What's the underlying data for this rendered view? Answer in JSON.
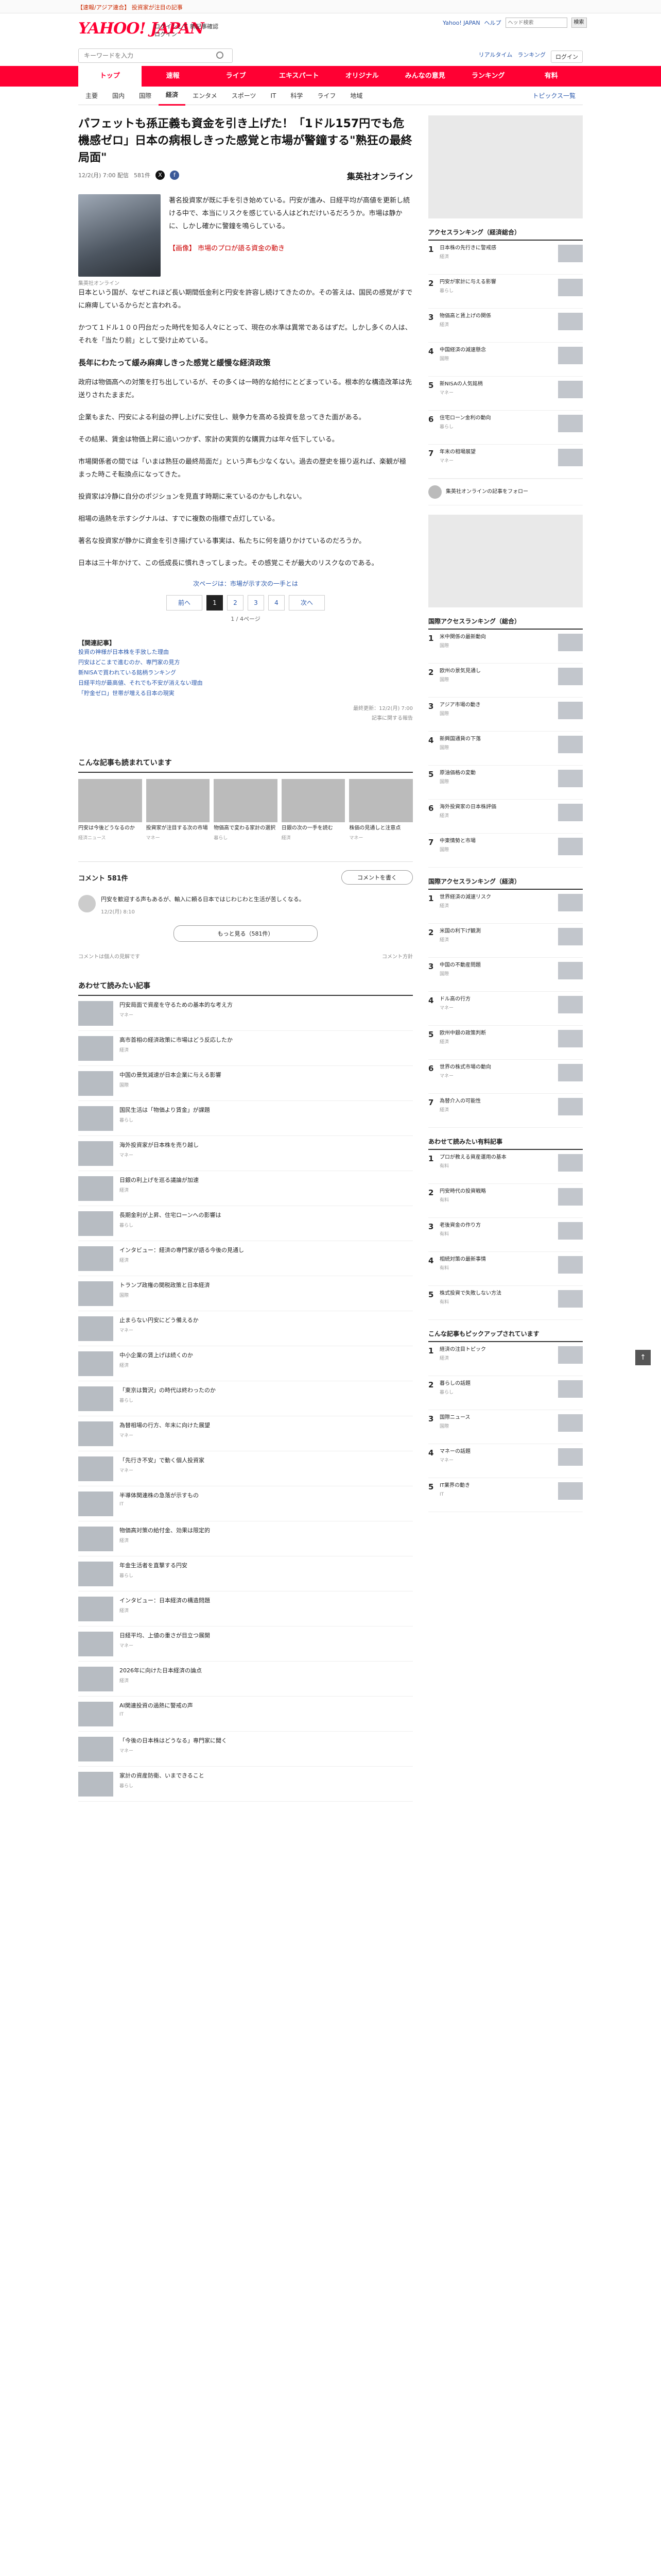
{
  "promo": "【速報/アジア連合】 投資家が注目の記事",
  "header": {
    "logo": "YAHOO! JAPAN",
    "logo_sub": "ニュース",
    "notice_line1": "ログインして 新記事確認",
    "notice_line2": "ログイン",
    "right_links": [
      "Yahoo! JAPAN",
      "ヘルプ"
    ],
    "right_placeholder": "ヘッド検索",
    "right_btn": "検索"
  },
  "search": {
    "placeholder": "キーワードを入力",
    "right": [
      "リアルタイム",
      "ランキング",
      "ログイン"
    ]
  },
  "nav": [
    "トップ",
    "速報",
    "ライブ",
    "エキスパート",
    "オリジナル",
    "みんなの意見",
    "ランキング",
    "有料"
  ],
  "subnav": [
    "主要",
    "国内",
    "国際",
    "経済",
    "エンタメ",
    "スポーツ",
    "IT",
    "科学",
    "ライフ",
    "地域"
  ],
  "subnav_topics": "トピックス一覧",
  "article": {
    "title": "パフェットも孫正義も資金を引き上げた！「1ドル157円でも危機感ゼロ」日本の病根しきった感覚と市場が警鐘する\"熟狂の最終局面\"",
    "date": "12/2(月) 7:00 配信",
    "comment_count": "581件",
    "publisher": "集英社オンライン",
    "photo_caption": "集英社オンライン",
    "lead": "著名投資家が既に手を引き始めている。円安が進み、日経平均が高値を更新し続ける中で、本当にリスクを感じている人はどれだけいるだろうか。市場は静かに、しかし確かに警鐘を鳴らしている。",
    "lead_red": "【画像】 市場のプロが語る資金の動き",
    "paragraphs": [
      "日本という国が、なぜこれほど長い期間低金利と円安を許容し続けてきたのか。その答えは、国民の感覚がすでに麻痺しているからだと言われる。",
      "かつて１ドル１００円台だった時代を知る人々にとって、現在の水準は異常であるはずだ。しかし多くの人は、それを「当たり前」として受け止めている。"
    ],
    "subhead": "長年にわたって緩み麻痺しきった感覚と緩慢な経済政策",
    "paragraphs2": [
      "政府は物価高への対策を打ち出しているが、その多くは一時的な給付にとどまっている。根本的な構造改革は先送りされたままだ。",
      "企業もまた、円安による利益の押し上げに安住し、競争力を高める投資を怠ってきた面がある。",
      "その結果、賃金は物価上昇に追いつかず、家計の実質的な購買力は年々低下している。",
      "市場関係者の間では「いまは熟狂の最終局面だ」という声も少なくない。過去の歴史を振り返れば、楽観が極まった時こそ転換点になってきた。",
      "投資家は冷静に自分のポジションを見直す時期に来ているのかもしれない。",
      "相場の過熱を示すシグナルは、すでに複数の指標で点灯している。",
      "著名な投資家が静かに資金を引き揚げている事実は、私たちに何を語りかけているのだろうか。",
      "日本は三十年かけて、この低成長に慣れきってしまった。その感覚こそが最大のリスクなのである。"
    ],
    "next_link": "次ページは：市場が示す次の一手とは",
    "pages": [
      "1",
      "2",
      "3",
      "4"
    ],
    "page_prev": "前へ",
    "page_next": "次へ",
    "page_note": "1 / 4ページ"
  },
  "related": {
    "heading": "【関連記事】",
    "items": [
      "投資の神様が日本株を手放した理由",
      "円安はどこまで進むのか、専門家の見方",
      "新NISAで買われている銘柄ランキング",
      "日経平均が最高値、それでも不安が消えない理由",
      "「貯金ゼロ」世帯が増える日本の現実"
    ],
    "footer": "最終更新：12/2(月) 7:00",
    "report": "記事に関する報告"
  },
  "more": {
    "heading": "こんな記事も読まれています",
    "cards": [
      {
        "t": "円安は今後どうなるのか",
        "s": "経済ニュース"
      },
      {
        "t": "投資家が注目する次の市場",
        "s": "マネー"
      },
      {
        "t": "物価高で変わる家計の選択",
        "s": "暮らし"
      },
      {
        "t": "日銀の次の一手を読む",
        "s": "経済"
      },
      {
        "t": "株価の見通しと注意点",
        "s": "マネー"
      }
    ]
  },
  "comments": {
    "title": "コメント 581件",
    "button": "コメントを書く",
    "items": [
      {
        "text": "円安を歓迎する声もあるが、輸入に頼る日本ではじわじわと生活が苦しくなる。",
        "meta": "12/2(月) 8:10"
      }
    ],
    "more": "もっと見る（581件）",
    "bottom_left": "コメントは個人の見解です",
    "bottom_right": "コメント方針"
  },
  "recommend": {
    "heading": "あわせて読みたい記事",
    "items": [
      {
        "t": "円安局面で資産を守るための基本的な考え方",
        "s": "マネー"
      },
      {
        "t": "高市首相の経済政策に市場はどう反応したか",
        "s": "経済"
      },
      {
        "t": "中国の景気減速が日本企業に与える影響",
        "s": "国際"
      },
      {
        "t": "国民生活は「物価より賃金」が課題",
        "s": "暮らし"
      },
      {
        "t": "海外投資家が日本株を売り越し",
        "s": "マネー"
      },
      {
        "t": "日銀の利上げを巡る議論が加速",
        "s": "経済"
      },
      {
        "t": "長期金利が上昇、住宅ローンへの影響は",
        "s": "暮らし"
      },
      {
        "t": "インタビュー：経済の専門家が語る今後の見通し",
        "s": "経済"
      },
      {
        "t": "トランプ政権の関税政策と日本経済",
        "s": "国際"
      },
      {
        "t": "止まらない円安にどう備えるか",
        "s": "マネー"
      },
      {
        "t": "中小企業の賃上げは続くのか",
        "s": "経済"
      },
      {
        "t": "「東京は贅沢」の時代は終わったのか",
        "s": "暮らし"
      },
      {
        "t": "為替相場の行方、年末に向けた展望",
        "s": "マネー"
      },
      {
        "t": "「先行き不安」で動く個人投資家",
        "s": "マネー"
      },
      {
        "t": "半導体関連株の急落が示すもの",
        "s": "IT"
      },
      {
        "t": "物価高対策の給付金、効果は限定的",
        "s": "経済"
      },
      {
        "t": "年金生活者を直撃する円安",
        "s": "暮らし"
      },
      {
        "t": "インタビュー：日本経済の構造問題",
        "s": "経済"
      },
      {
        "t": "日経平均、上値の重さが目立つ展開",
        "s": "マネー"
      },
      {
        "t": "2026年に向けた日本経済の論点",
        "s": "経済"
      },
      {
        "t": "AI関連投資の過熱に警戒の声",
        "s": "IT"
      },
      {
        "t": "「今後の日本株はどうなる」専門家に聞く",
        "s": "マネー"
      },
      {
        "t": "家計の資産防衛、いまできること",
        "s": "暮らし"
      }
    ]
  },
  "sidebar": {
    "access_heading": "アクセスランキング（経済総合）",
    "access": [
      {
        "t": "日本株の先行きに警戒感",
        "s": "経済"
      },
      {
        "t": "円安が家計に与える影響",
        "s": "暮らし"
      },
      {
        "t": "物価高と賃上げの関係",
        "s": "経済"
      },
      {
        "t": "中国経済の減速懸念",
        "s": "国際"
      },
      {
        "t": "新NISAの人気銘柄",
        "s": "マネー"
      },
      {
        "t": "住宅ローン金利の動向",
        "s": "暮らし"
      },
      {
        "t": "年末の相場展望",
        "s": "マネー"
      }
    ],
    "author": "集英社オンラインの記事をフォロー",
    "access2_heading": "国際アクセスランキング（総合）",
    "access2": [
      {
        "t": "米中関係の最新動向",
        "s": "国際"
      },
      {
        "t": "欧州の景気見通し",
        "s": "国際"
      },
      {
        "t": "アジア市場の動き",
        "s": "国際"
      },
      {
        "t": "新興国通貨の下落",
        "s": "国際"
      },
      {
        "t": "原油価格の変動",
        "s": "国際"
      },
      {
        "t": "海外投資家の日本株評価",
        "s": "経済"
      },
      {
        "t": "中東情勢と市場",
        "s": "国際"
      }
    ],
    "access3_heading": "国際アクセスランキング（経済）",
    "access3": [
      {
        "t": "世界経済の減速リスク",
        "s": "経済"
      },
      {
        "t": "米国の利下げ観測",
        "s": "経済"
      },
      {
        "t": "中国の不動産問題",
        "s": "国際"
      },
      {
        "t": "ドル高の行方",
        "s": "マネー"
      },
      {
        "t": "欧州中銀の政策判断",
        "s": "経済"
      },
      {
        "t": "世界の株式市場の動向",
        "s": "マネー"
      },
      {
        "t": "為替介入の可能性",
        "s": "経済"
      }
    ],
    "pr_heading": "あわせて読みたい有料記事",
    "pr": [
      {
        "t": "プロが教える資産運用の基本",
        "s": "有料"
      },
      {
        "t": "円安時代の投資戦略",
        "s": "有料"
      },
      {
        "t": "老後資金の作り方",
        "s": "有料"
      },
      {
        "t": "相続対策の最新事情",
        "s": "有料"
      },
      {
        "t": "株式投資で失敗しない方法",
        "s": "有料"
      }
    ],
    "topic_heading": "こんな記事もピックアップされています",
    "topic": [
      {
        "t": "経済の注目トピック",
        "s": "経済"
      },
      {
        "t": "暮らしの話題",
        "s": "暮らし"
      },
      {
        "t": "国際ニュース",
        "s": "国際"
      },
      {
        "t": "マネーの話題",
        "s": "マネー"
      },
      {
        "t": "IT業界の動き",
        "s": "IT"
      }
    ]
  }
}
